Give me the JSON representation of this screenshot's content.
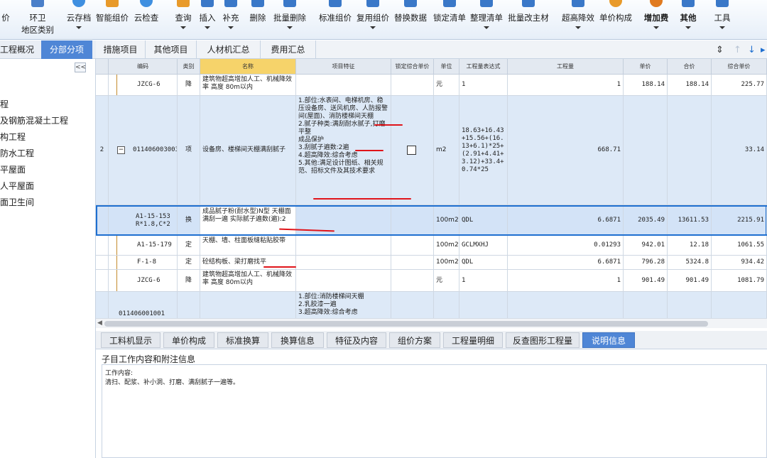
{
  "toolbar": {
    "items": [
      {
        "label": "价",
        "label2": "",
        "has_dropdown": false
      },
      {
        "label": "环卫",
        "label2": "地区类别",
        "has_dropdown": false
      },
      {
        "label": "云存档",
        "label2": "",
        "has_dropdown": true
      },
      {
        "label": "智能组价",
        "label2": "",
        "has_dropdown": false
      },
      {
        "label": "云检查",
        "label2": "",
        "has_dropdown": false
      },
      {
        "label": "查询",
        "label2": "",
        "has_dropdown": true
      },
      {
        "label": "插入",
        "label2": "",
        "has_dropdown": true
      },
      {
        "label": "补充",
        "label2": "",
        "has_dropdown": true
      },
      {
        "label": "删除",
        "label2": "",
        "has_dropdown": false
      },
      {
        "label": "批量删除",
        "label2": "",
        "has_dropdown": true
      },
      {
        "label": "标准组价",
        "label2": "",
        "has_dropdown": false
      },
      {
        "label": "复用组价",
        "label2": "",
        "has_dropdown": true
      },
      {
        "label": "替换数据",
        "label2": "",
        "has_dropdown": false
      },
      {
        "label": "锁定清单",
        "label2": "",
        "has_dropdown": false
      },
      {
        "label": "整理清单",
        "label2": "",
        "has_dropdown": true
      },
      {
        "label": "批量改主材",
        "label2": "",
        "has_dropdown": false
      },
      {
        "label": "超高降效",
        "label2": "",
        "has_dropdown": true
      },
      {
        "label": "单价构成",
        "label2": "",
        "has_dropdown": false
      },
      {
        "label": "增加费",
        "label2": "",
        "has_dropdown": true
      },
      {
        "label": "其他",
        "label2": "",
        "has_dropdown": true
      },
      {
        "label": "工具",
        "label2": "",
        "has_dropdown": true
      }
    ]
  },
  "left_tabs": [
    "工程概况",
    "分部分项"
  ],
  "left_tree": [
    "程",
    "及钢筋混凝土工程",
    "构工程",
    "防水工程",
    "平屋面",
    "人平屋面",
    "面卫生间"
  ],
  "main_tabs": [
    "措施项目",
    "其他项目",
    "人材机汇总",
    "费用汇总"
  ],
  "grid": {
    "headers": [
      "编码",
      "类别",
      "名称",
      "项目特征",
      "锁定综合单价",
      "单位",
      "工程量表达式",
      "工程量",
      "单价",
      "合价",
      "综合单价"
    ],
    "rows": [
      {
        "num": "",
        "code": "JZCG-6",
        "type": "降",
        "name": "建筑物超高增加人工、机械降效率 高度 80m以内",
        "feature": "",
        "unit": "元",
        "expr": "1",
        "qty": "1",
        "price": "188.14",
        "total": "188.14",
        "comp": "225.77"
      },
      {
        "num": "2",
        "code": "011406003003",
        "type": "项",
        "name": "设备房、楼梯间天棚满刮腻子",
        "feature": "1.部位:水表间、电梯机房、稳压设备房、送风机房、人防报警间(屋面)、消防楼梯间天棚\n2.腻子种类:满刮耐水腻子,打磨平整\n成品保护\n3.刮腻子遍数:2遍\n4.超高降效:综合考虑\n5.其他:满足设计图纸、相关规范、招标文件及其技术要求",
        "unit": "m2",
        "expr": "18.63+16.43+15.56+(16.13+6.1)*25+(2.91+4.41+3.12)+33.4+0.74*25",
        "qty": "668.71",
        "price": "",
        "total": "",
        "comp": "33.14"
      },
      {
        "num": "",
        "code": "A1-15-153 R*1.8,C*2",
        "type": "换",
        "name": "成品腻子粉(耐水型)N型 天棚面 满刮一遍 实际腻子遍数(遍):2",
        "feature": "",
        "unit": "100m2",
        "expr": "QDL",
        "qty": "6.6871",
        "price": "2035.49",
        "total": "13611.53",
        "comp": "2215.91"
      },
      {
        "num": "",
        "code": "A1-15-179",
        "type": "定",
        "name": "天棚、墙、柱面板缝粘贴胶带",
        "feature": "",
        "unit": "100m2",
        "expr": "GCLMXHJ",
        "qty": "0.01293",
        "price": "942.01",
        "total": "12.18",
        "comp": "1061.55"
      },
      {
        "num": "",
        "code": "F-1-8",
        "type": "定",
        "name": "砼结构板、梁打磨找平",
        "feature": "",
        "unit": "100m2",
        "expr": "QDL",
        "qty": "6.6871",
        "price": "796.28",
        "total": "5324.8",
        "comp": "934.42"
      },
      {
        "num": "",
        "code": "JZCG-6",
        "type": "降",
        "name": "建筑物超高增加人工、机械降效率 高度 80m以内",
        "feature": "",
        "unit": "元",
        "expr": "1",
        "qty": "1",
        "price": "901.49",
        "total": "901.49",
        "comp": "1081.79"
      },
      {
        "num": "",
        "code": "011406001001",
        "type": "",
        "name": "",
        "feature": "1.部位:消防楼梯间天棚\n2.乳胶漆一遍\n3.超高降效:综合考虑",
        "unit": "",
        "expr": "",
        "qty": "",
        "price": "",
        "total": "",
        "comp": ""
      }
    ]
  },
  "bottom_tabs": [
    "工料机显示",
    "单价构成",
    "标准换算",
    "换算信息",
    "特征及内容",
    "组价方案",
    "工程量明细",
    "反查图形工程量",
    "说明信息"
  ],
  "description": {
    "title": "子目工作内容和附注信息",
    "line1": "工作内容:",
    "line2": "清扫、配浆、补小洞、打磨、满刮腻子一遍等。"
  },
  "colors": {
    "accent": "#1e6fd0",
    "active_tab": "#4f86d6",
    "annotation": "#e0141a",
    "header_selected": "#f6d36a"
  }
}
